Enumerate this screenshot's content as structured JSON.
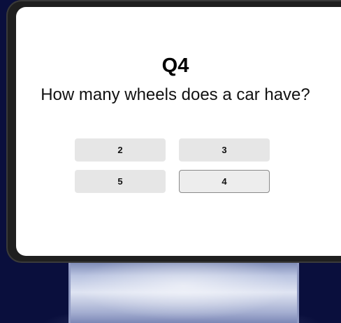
{
  "quiz": {
    "question_number": "Q4",
    "question_text": "How many wheels does a car have?",
    "answers": [
      {
        "label": "2",
        "selected": false
      },
      {
        "label": "3",
        "selected": false
      },
      {
        "label": "5",
        "selected": false
      },
      {
        "label": "4",
        "selected": true
      }
    ]
  },
  "colors": {
    "background": "#0a0f3d",
    "bezel": "#1f1f1f",
    "screen": "#ffffff",
    "answer_button": "#e6e6e6",
    "selected_border": "#8a8a8a"
  }
}
